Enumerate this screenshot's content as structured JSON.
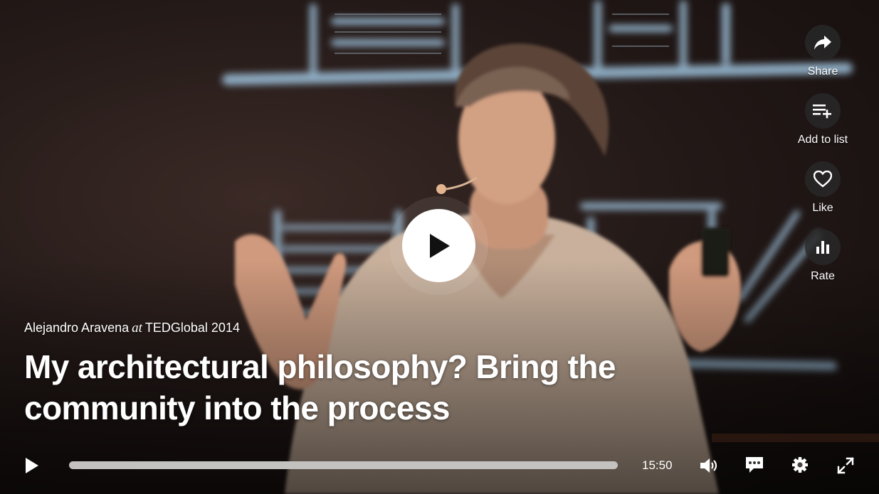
{
  "talk": {
    "speaker": "Alejandro Aravena",
    "at": "at",
    "event": "TEDGlobal 2014",
    "title": "My architectural philosophy? Bring the community into the process"
  },
  "actions": [
    {
      "label": "Share",
      "icon": "share-icon"
    },
    {
      "label": "Add to list",
      "icon": "playlist-add-icon"
    },
    {
      "label": "Like",
      "icon": "heart-icon"
    },
    {
      "label": "Rate",
      "icon": "bar-chart-icon"
    }
  ],
  "player": {
    "duration": "15:50",
    "progress": 0,
    "accent_color": "#e62b1e"
  }
}
